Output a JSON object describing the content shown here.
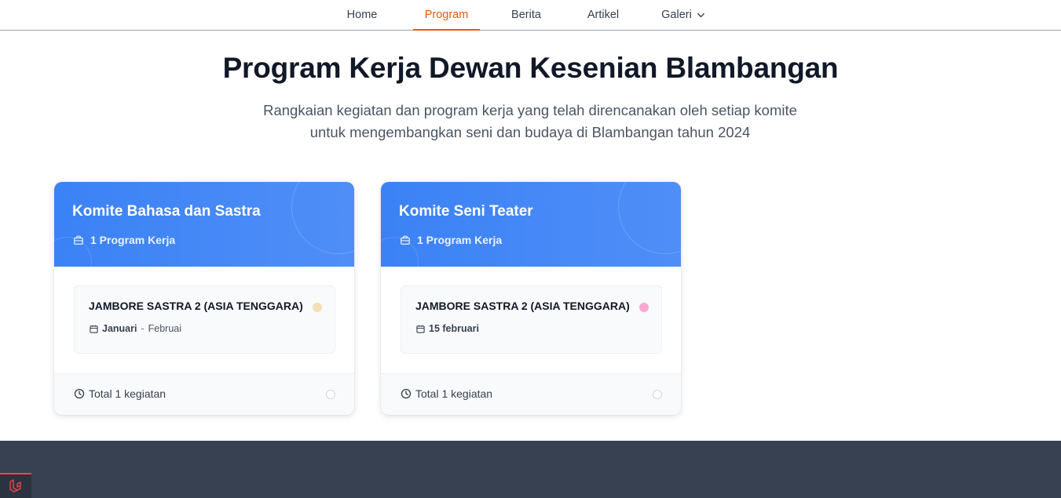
{
  "nav": {
    "items": [
      {
        "label": "Home"
      },
      {
        "label": "Program"
      },
      {
        "label": "Berita"
      },
      {
        "label": "Artikel"
      },
      {
        "label": "Galeri"
      }
    ],
    "active": "Program",
    "active_color": "#ea580c"
  },
  "hero": {
    "title": "Program Kerja Dewan Kesenian Blambangan",
    "subtitle_line1": "Rangkaian kegiatan dan program kerja yang telah direncanakan oleh setiap komite",
    "subtitle_line2": "untuk mengembangkan seni dan budaya di Blambangan tahun 2024"
  },
  "cards": [
    {
      "title": "Komite Bahasa dan Sastra",
      "count_label": "1 Program Kerja",
      "header_color": "#3b82f6",
      "program": {
        "title": "JAMBORE SASTRA 2 (ASIA TENGGARA)",
        "date_start": "Januari",
        "date_sep": "-",
        "date_end": "Februai",
        "dot_color": "#f5deb3"
      },
      "footer_label": "Total 1 kegiatan",
      "icons": [
        "briefcase-icon",
        "calendar-icon",
        "clock-icon"
      ]
    },
    {
      "title": "Komite Seni Teater",
      "count_label": "1 Program Kerja",
      "header_color": "#3b82f6",
      "program": {
        "title": "JAMBORE SASTRA 2 (ASIA TENGGARA)",
        "date_start": "15 februari",
        "dot_color": "#f9a8d4"
      },
      "footer_label": "Total 1 kegiatan",
      "icons": [
        "briefcase-icon",
        "calendar-icon",
        "clock-icon"
      ]
    }
  ],
  "footer": {
    "background": "#374151",
    "badge_icon": "laravel-logo-icon"
  }
}
